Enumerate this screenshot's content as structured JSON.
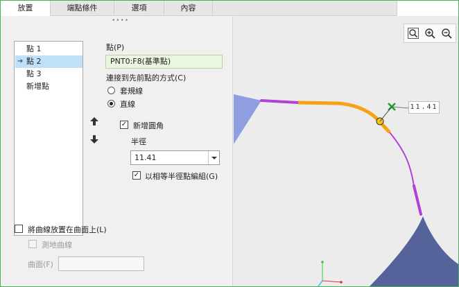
{
  "tabs": [
    {
      "label": "放置",
      "active": true
    },
    {
      "label": "端點條件",
      "active": false
    },
    {
      "label": "選項",
      "active": false
    },
    {
      "label": "內容",
      "active": false
    }
  ],
  "point_list": {
    "items": [
      "點 1",
      "點 2",
      "點 3",
      "新增點"
    ],
    "selected_index": 1
  },
  "point_field": {
    "label": "點(P)",
    "value": "PNT0:F8(基準點)"
  },
  "connect": {
    "label": "連接到先前點的方式(C)",
    "options": [
      "套規線",
      "直線"
    ],
    "selected": "直線"
  },
  "fillet": {
    "label": "新增圓角",
    "checked": true,
    "radius_label": "半徑",
    "radius_value": "11.41",
    "group_label": "以相等半徑點編組(G)",
    "group_checked": true
  },
  "surface": {
    "place_label": "將曲線放置在曲面上(L)",
    "place_checked": false,
    "geodesic_label": "測地曲線",
    "surface_label": "曲面(F)",
    "surface_value": ""
  },
  "viewport": {
    "dimension_value": "11.41",
    "toolbar": [
      "zoom-fit-icon",
      "zoom-in-icon",
      "zoom-out-icon"
    ]
  },
  "colors": {
    "accent_green": "#49b05a",
    "curve_orange": "#f5a314",
    "curve_purple": "#b042d6",
    "surface_light": "#8e9ee0",
    "surface_dark": "#56639b",
    "selection_blue": "#bfe0f7"
  }
}
